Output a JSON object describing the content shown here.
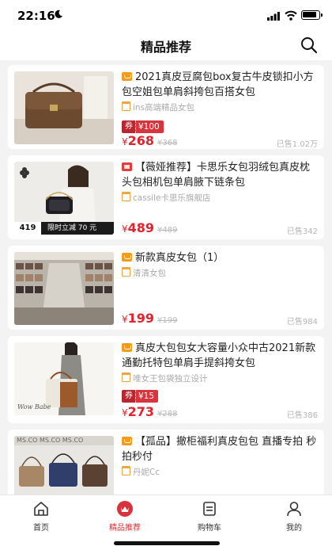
{
  "status_bar": {
    "time": "22:16"
  },
  "nav": {
    "title": "精品推荐"
  },
  "products": [
    {
      "title": "2021真皮豆腐包box复古牛皮锁扣小方包空姐包单肩斜挎包百搭女包",
      "platform_icon": "tmall-icon",
      "shop": "ins高端精品女包",
      "coupon_label": "券",
      "coupon_value": "¥100",
      "currency": "¥",
      "price": "268",
      "original_price": "¥368",
      "sold": "已售1.02万"
    },
    {
      "title": "【薇娅推荐】卡思乐女包羽绒包真皮枕头包相机包单肩腋下链条包",
      "platform_icon": "jd-icon",
      "shop": "cassile卡思乐旗舰店",
      "thumb_price": "419",
      "thumb_promo": "限时立减 70 元",
      "currency": "¥",
      "price": "489",
      "original_price": "¥489",
      "sold": "已售342"
    },
    {
      "title": "新款真皮女包（1）",
      "platform_icon": "tmall-icon",
      "shop": "清清女包",
      "currency": "¥",
      "price": "199",
      "original_price": "¥199",
      "sold": "已售984"
    },
    {
      "title": "真皮大包包女大容量小众中古2021新款通勤托特包单肩手提斜挎女包",
      "platform_icon": "tmall-icon",
      "shop": "唯女王包袋独立设计",
      "coupon_label": "券",
      "coupon_value": "¥15",
      "thumb_text": "Wow Babe",
      "currency": "¥",
      "price": "273",
      "original_price": "¥288",
      "sold": "已售386"
    },
    {
      "title": "【孤品】撤柜福利真皮包包 直播专拍 秒拍秒付",
      "platform_icon": "tmall-icon",
      "shop": "丹妮Cc",
      "thumb_text": "MS.CO MS.CO MS.CO"
    }
  ],
  "tabbar": {
    "items": [
      {
        "label": "首页",
        "icon": "home-icon"
      },
      {
        "label": "精品推荐",
        "icon": "recommend-icon"
      },
      {
        "label": "购物车",
        "icon": "cart-icon"
      },
      {
        "label": "我的",
        "icon": "user-icon"
      }
    ],
    "active_color": "#d8323a"
  },
  "colors": {
    "price": "#e0242d",
    "coupon": "#d7353d",
    "background": "#f3f3f3"
  }
}
